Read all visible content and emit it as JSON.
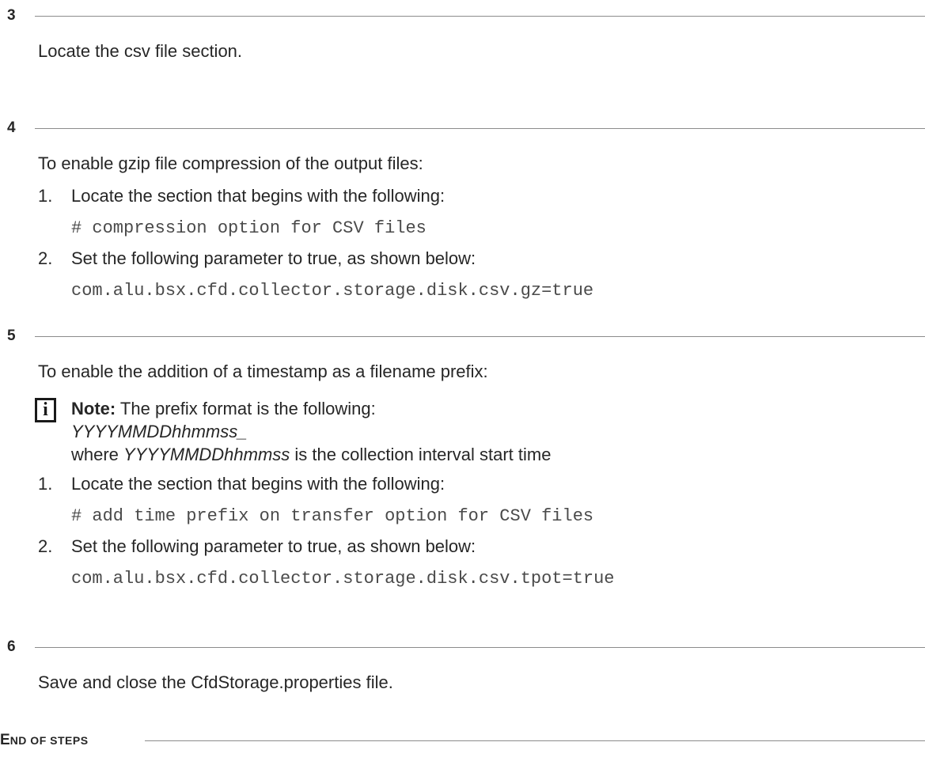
{
  "steps": [
    {
      "number": "3"
    },
    {
      "number": "4"
    },
    {
      "number": "5"
    },
    {
      "number": "6"
    }
  ],
  "step3": {
    "text": "Locate the csv file section."
  },
  "step4": {
    "intro": "To enable gzip file compression of the output files:",
    "item1_num": "1.",
    "item1_text": "Locate the section that begins with the following:",
    "item1_code": "# compression option for CSV files",
    "item2_num": "2.",
    "item2_text": "Set the following parameter to true, as shown below:",
    "item2_code": "com.alu.bsx.cfd.collector.storage.disk.csv.gz=true"
  },
  "step5": {
    "intro": "To enable the addition of a timestamp as a filename prefix:",
    "note_icon": "i",
    "note_label": "Note:",
    "note_line1": " The prefix format is the following:",
    "note_format": "YYYYMMDDhhmmss_",
    "note_where": "where ",
    "note_where_italic": "YYYYMMDDhhmmss",
    "note_where_rest": " is the collection interval start time",
    "item1_num": "1.",
    "item1_text": "Locate the section that begins with the following:",
    "item1_code": "# add time prefix on transfer option for CSV files",
    "item2_num": "2.",
    "item2_text": "Set the following parameter to true, as shown below:",
    "item2_code": "com.alu.bsx.cfd.collector.storage.disk.csv.tpot=true"
  },
  "step6": {
    "text": "Save and close the CfdStorage.properties file."
  },
  "end": {
    "first_letter": "E",
    "rest": "ND OF STEPS"
  }
}
